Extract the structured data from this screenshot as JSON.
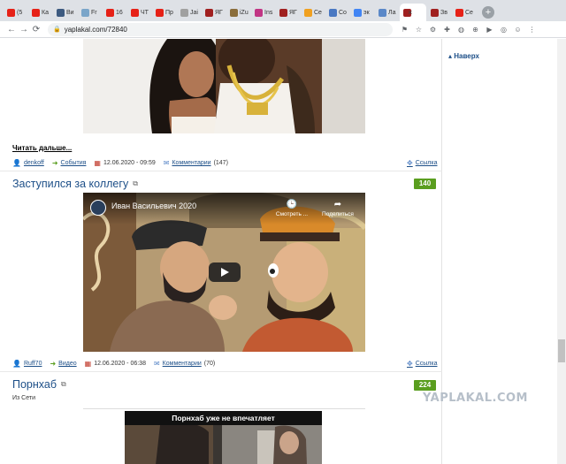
{
  "browser": {
    "tabs": [
      {
        "label": "(5",
        "color": "#e62117"
      },
      {
        "label": "Ка",
        "color": "#e62117"
      },
      {
        "label": "Ви",
        "color": "#3d5a80"
      },
      {
        "label": "Fr",
        "color": "#7aa5c9"
      },
      {
        "label": "16",
        "color": "#e62117"
      },
      {
        "label": "ЧТ",
        "color": "#e62117"
      },
      {
        "label": "Пр",
        "color": "#e62117"
      },
      {
        "label": "Jai",
        "color": "#a0a0a0"
      },
      {
        "label": "ЯГ",
        "color": "#a02020"
      },
      {
        "label": "iZu",
        "color": "#8a6d3b"
      },
      {
        "label": "Ins",
        "color": "#c13584"
      },
      {
        "label": "ЯГ",
        "color": "#a02020"
      },
      {
        "label": "Се",
        "color": "#f0a020"
      },
      {
        "label": "Со",
        "color": "#4a78c2"
      },
      {
        "label": "эк",
        "color": "#4285f4"
      },
      {
        "label": "Ла",
        "color": "#5b88c8"
      },
      {
        "label": "",
        "color": "#a02020",
        "active": true
      },
      {
        "label": "Зв",
        "color": "#a02020"
      },
      {
        "label": "Се",
        "color": "#e62117"
      }
    ],
    "close_glyph": "×",
    "newtab_glyph": "+",
    "url": "yaplakal.com/72840",
    "nav": {
      "back": "←",
      "forward": "→",
      "reload": "⟳"
    },
    "extensions": [
      "⚑",
      "☆",
      "⚙",
      "✚",
      "◍",
      "⊕",
      "▶",
      "◎",
      "☺",
      "⋮"
    ]
  },
  "sidebar": {
    "naverh": "▴ Наверх"
  },
  "post1": {
    "read_more": "Читать дальше...",
    "author": "denkoff",
    "category": "События",
    "date": "12.06.2020 - 09:59",
    "comments_label": "Комментарии",
    "comments_count": "(147)",
    "link": "Ссылка"
  },
  "post2": {
    "title": "Заступился за коллегу",
    "rating": "140",
    "video_title": "Иван Васильевич 2020",
    "watch_later": "Смотреть ...",
    "share": "Поделиться",
    "author": "Ruff70",
    "category": "Видео",
    "date": "12.06.2020 - 06:38",
    "comments_label": "Комментарии",
    "comments_count": "(70)",
    "link": "Ссылка"
  },
  "post3": {
    "title": "Порнхаб",
    "rating": "224",
    "source": "Из Сети",
    "image_caption": "Порнхаб уже не впечатляет"
  },
  "watermark": "YAPLAKAL.COM",
  "colors": {
    "link": "#1d4f88",
    "rating": "#5a9e1f"
  }
}
